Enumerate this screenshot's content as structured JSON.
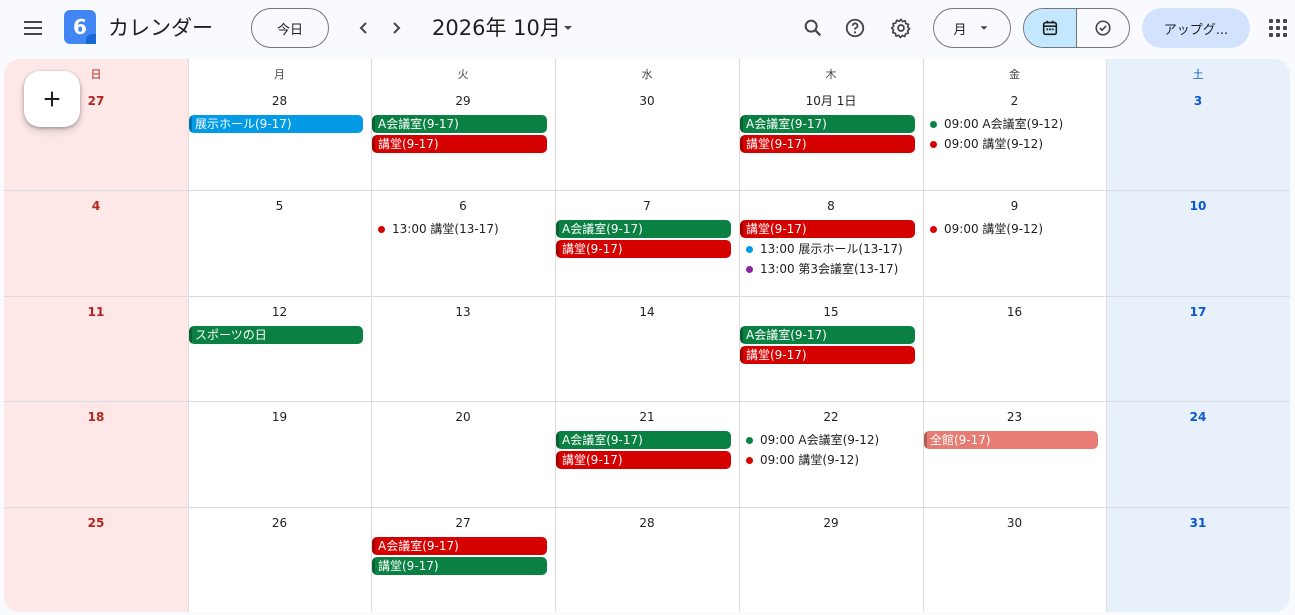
{
  "header": {
    "logo_text": "6",
    "app_title": "カレンダー",
    "today_label": "今日",
    "month_label": "2026年 10月",
    "view_label": "月",
    "upgrade_label": "アップグ..."
  },
  "weekdays": [
    "日",
    "月",
    "火",
    "水",
    "木",
    "金",
    "土"
  ],
  "weeks": [
    {
      "days": [
        "27",
        "28",
        "29",
        "30",
        "10月 1日",
        "2",
        "3"
      ]
    },
    {
      "days": [
        "4",
        "5",
        "6",
        "7",
        "8",
        "9",
        "10"
      ]
    },
    {
      "days": [
        "11",
        "12",
        "13",
        "14",
        "15",
        "16",
        "17"
      ]
    },
    {
      "days": [
        "18",
        "19",
        "20",
        "21",
        "22",
        "23",
        "24"
      ]
    },
    {
      "days": [
        "25",
        "26",
        "27",
        "28",
        "29",
        "30",
        "31"
      ]
    }
  ],
  "colors": {
    "green": "#0b8043",
    "red": "#d50000",
    "blue": "#039be5",
    "purple": "#8e24aa",
    "salmon": "#e67c73",
    "weekend_sun_bg": "#fde7e7",
    "weekend_sat_bg": "#e8f1fb"
  },
  "events": [
    {
      "week": 0,
      "col": 1,
      "row": 0,
      "type": "bar",
      "color": "blue",
      "label": "展示ホール(9-17)"
    },
    {
      "week": 0,
      "col": 2,
      "row": 0,
      "type": "bar",
      "color": "green",
      "label": "A会議室(9-17)"
    },
    {
      "week": 0,
      "col": 2,
      "row": 1,
      "type": "bar",
      "color": "red",
      "label": "講堂(9-17)"
    },
    {
      "week": 0,
      "col": 4,
      "row": 0,
      "type": "bar",
      "color": "green",
      "label": "A会議室(9-17)"
    },
    {
      "week": 0,
      "col": 4,
      "row": 1,
      "type": "bar",
      "color": "red",
      "label": "講堂(9-17)"
    },
    {
      "week": 0,
      "col": 5,
      "row": 0,
      "type": "dot",
      "color": "green",
      "label": "09:00 A会議室(9-12)"
    },
    {
      "week": 0,
      "col": 5,
      "row": 1,
      "type": "dot",
      "color": "red",
      "label": "09:00 講堂(9-12)"
    },
    {
      "week": 1,
      "col": 2,
      "row": 0,
      "type": "dot",
      "color": "red",
      "label": "13:00 講堂(13-17)"
    },
    {
      "week": 1,
      "col": 3,
      "row": 0,
      "type": "bar",
      "color": "green",
      "label": "A会議室(9-17)"
    },
    {
      "week": 1,
      "col": 3,
      "row": 1,
      "type": "bar",
      "color": "red",
      "label": "講堂(9-17)"
    },
    {
      "week": 1,
      "col": 4,
      "row": 0,
      "type": "bar",
      "color": "red",
      "label": "講堂(9-17)"
    },
    {
      "week": 1,
      "col": 4,
      "row": 1,
      "type": "dot",
      "color": "blue",
      "label": "13:00 展示ホール(13-17)"
    },
    {
      "week": 1,
      "col": 4,
      "row": 2,
      "type": "dot",
      "color": "purple",
      "label": "13:00 第3会議室(13-17)"
    },
    {
      "week": 1,
      "col": 5,
      "row": 0,
      "type": "dot",
      "color": "red",
      "label": "09:00 講堂(9-12)"
    },
    {
      "week": 2,
      "col": 1,
      "row": 0,
      "type": "bar",
      "color": "green",
      "label": "スポーツの日"
    },
    {
      "week": 2,
      "col": 4,
      "row": 0,
      "type": "bar",
      "color": "green",
      "label": "A会議室(9-17)"
    },
    {
      "week": 2,
      "col": 4,
      "row": 1,
      "type": "bar",
      "color": "red",
      "label": "講堂(9-17)"
    },
    {
      "week": 3,
      "col": 3,
      "row": 0,
      "type": "bar",
      "color": "green",
      "label": "A会議室(9-17)"
    },
    {
      "week": 3,
      "col": 3,
      "row": 1,
      "type": "bar",
      "color": "red",
      "label": "講堂(9-17)"
    },
    {
      "week": 3,
      "col": 4,
      "row": 0,
      "type": "dot",
      "color": "green",
      "label": "09:00 A会議室(9-12)"
    },
    {
      "week": 3,
      "col": 4,
      "row": 1,
      "type": "dot",
      "color": "red",
      "label": "09:00 講堂(9-12)"
    },
    {
      "week": 3,
      "col": 5,
      "row": 0,
      "type": "bar",
      "color": "salmon",
      "label": "全館(9-17)"
    },
    {
      "week": 4,
      "col": 2,
      "row": 0,
      "type": "bar",
      "color": "red",
      "label": "A会議室(9-17)"
    },
    {
      "week": 4,
      "col": 2,
      "row": 1,
      "type": "bar",
      "color": "green",
      "label": "講堂(9-17)"
    }
  ]
}
